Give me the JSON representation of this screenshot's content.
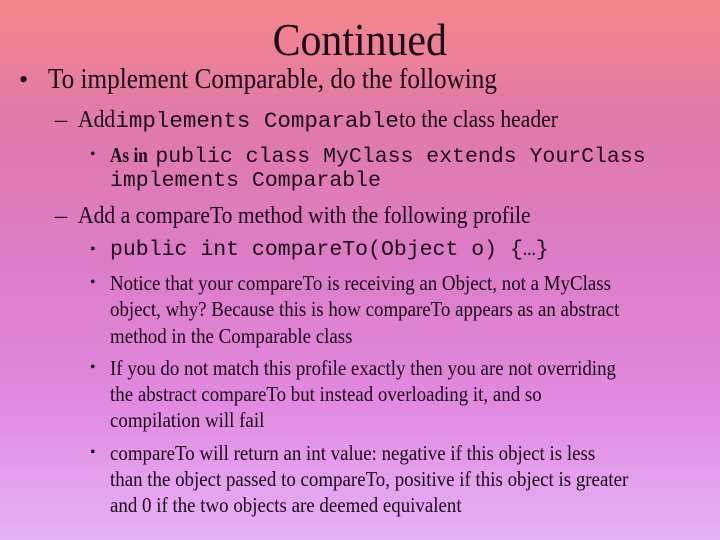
{
  "slide": {
    "title": "Continued",
    "background": {
      "gradient_top": "#f5868a",
      "gradient_mid": "#dc7cc6",
      "gradient_bottom": "#e6b2f6"
    },
    "text_color": "#1a0818",
    "bullet_glyph": "•",
    "dash_glyph": "–",
    "content": {
      "item1": {
        "text": "To implement Comparable, do the following",
        "sub1": {
          "prefix": "Add ",
          "code": "implements Comparable",
          "suffix": " to the class header",
          "example": {
            "prefix": "As in",
            "code_line1": "public class MyClass extends YourClass",
            "code_line2": "implements Comparable"
          }
        },
        "sub2": {
          "text": "Add a compareTo method with the following profile",
          "points": {
            "code_profile": "public int compareTo(Object o) {…}",
            "notice": {
              "line1": "Notice that your compareTo is receiving an Object, not a MyClass",
              "line2": "object, why?  Because this is how compareTo appears as an abstract",
              "line3": "method in the Comparable class"
            },
            "overriding": {
              "line1": "If you do not match this profile exactly then you are not overriding",
              "line2": "the abstract compareTo but instead overloading it, and so",
              "line3": "compilation will fail"
            },
            "return_value": {
              "line1": "compareTo will return an int value: negative if this object is less",
              "line2": "than the object passed to compareTo, positive if this object is greater",
              "line3": "and 0 if the two objects are deemed equivalent"
            }
          }
        }
      }
    }
  }
}
